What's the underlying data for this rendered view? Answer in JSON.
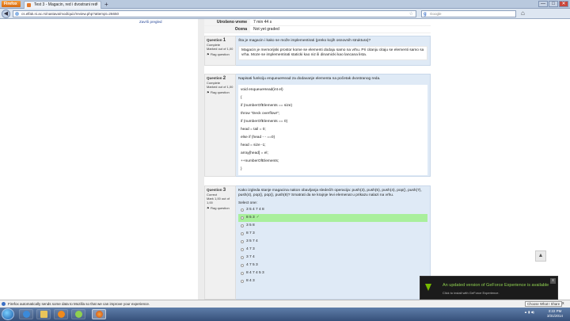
{
  "browser": {
    "menu_button": "Firefox",
    "tab_title": "Test 3 - Magacin, red i dvostrani red",
    "new_tab": "+",
    "url": "cs.elfak.ni.ac.rs/nastava/mod/quiz/review.php?attempt=26650",
    "search_engine": "Google",
    "window_buttons": [
      "—",
      "□",
      "✕"
    ]
  },
  "left_panel": {
    "link": "Završi pregled"
  },
  "summary": {
    "rows": [
      {
        "label": "Utrošeno vreme",
        "value": "7 min 44 s"
      },
      {
        "label": "Ocena",
        "value": "Not yet graded"
      }
    ]
  },
  "questions": [
    {
      "label": "Question",
      "number": "1",
      "state": "Complete",
      "marks": "Marked out of 1,00",
      "flag": "Flag question",
      "text": "Šta je magacin i kako se može implementirati (preko kojih osnovnih struktura)?",
      "answer": "Magacin je memorijski prostor kome se elementi dodaju samo na vrhu. Pri citanju citaju se elementi samo sa vrha. Moze se implementirati staticki kao niz ili dinamicki kao lancana lista."
    },
    {
      "label": "Question",
      "number": "2",
      "state": "Complete",
      "marks": "Marked out of 1,00",
      "flag": "Flag question",
      "text": "Napisati funkciju enqueueHead za dodavanje elementa na početak dvostranog reda.",
      "code": [
        "void enqueueHead(int el)",
        "{",
        "if (numberOfElements == size)",
        "throw \"Deck overflow!\";",
        "if (numberOfElements == 0)",
        "head = tail = 0;",
        "else if (head - - ==0)",
        "head = size -1;",
        "array[head] = el;",
        "++numberOfElements;",
        "}"
      ]
    },
    {
      "label": "Question",
      "number": "3",
      "state": "Correct",
      "marks": "Mark 1,00 out of 1,00",
      "flag": "Flag question",
      "text": "Kako izgleda stanje magacina nakon obavljanja sledećih operacija: push(3), push(5), push(4), pop(), push(7), push(4), pop(), pop(), push(8)? Smatrati da se krajnje levi elemenat u prikazu nalazi na vrhu.",
      "select_label": "Select one:",
      "options": [
        "3 5 4 7 4 8",
        "8 5 3",
        "3 5 8",
        "8 7 3",
        "3 5 7 4",
        "4 7 3",
        "3 7 4",
        "4 7 5 3",
        "8 4 7 4 5 3",
        "8 4 3"
      ],
      "correct_index": 1,
      "tick": "✓"
    }
  ],
  "notification": {
    "title": "An updated version of GeForce Experience is available",
    "subtitle": "Click to install with GeForce Experience.",
    "close": "x"
  },
  "status_bar": {
    "message": "Firefox automatically sends some data to Mozilla so that we can improve your experience.",
    "button": "Choose What I Share",
    "close": "x"
  },
  "taskbar": {
    "time": "3:22 PM",
    "date": "3/31/2014"
  },
  "colors": {
    "question_bg": "#dfeaf6",
    "correct_bg": "#a9ef9c",
    "geforce_green": "#76b900"
  }
}
